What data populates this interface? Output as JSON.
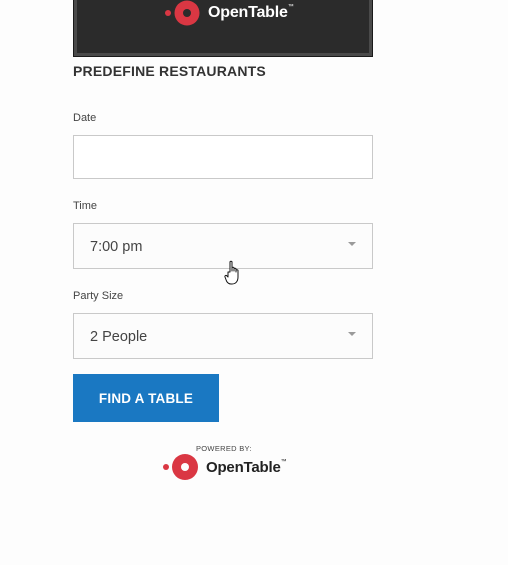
{
  "banner": {
    "brand": "OpenTable",
    "tm": "™"
  },
  "section_title": "PREDEFINE RESTAURANTS",
  "fields": {
    "date": {
      "label": "Date",
      "value": ""
    },
    "time": {
      "label": "Time",
      "value": "7:00 pm"
    },
    "party_size": {
      "label": "Party Size",
      "value": "2 People"
    }
  },
  "button": {
    "label": "FIND A TABLE"
  },
  "footer": {
    "powered_by": "POWERED BY:",
    "brand": "OpenTable",
    "tm": "™"
  },
  "colors": {
    "button_bg": "#1a78c2",
    "brand_red": "#da3743",
    "banner_bg": "#2b2b2b"
  }
}
